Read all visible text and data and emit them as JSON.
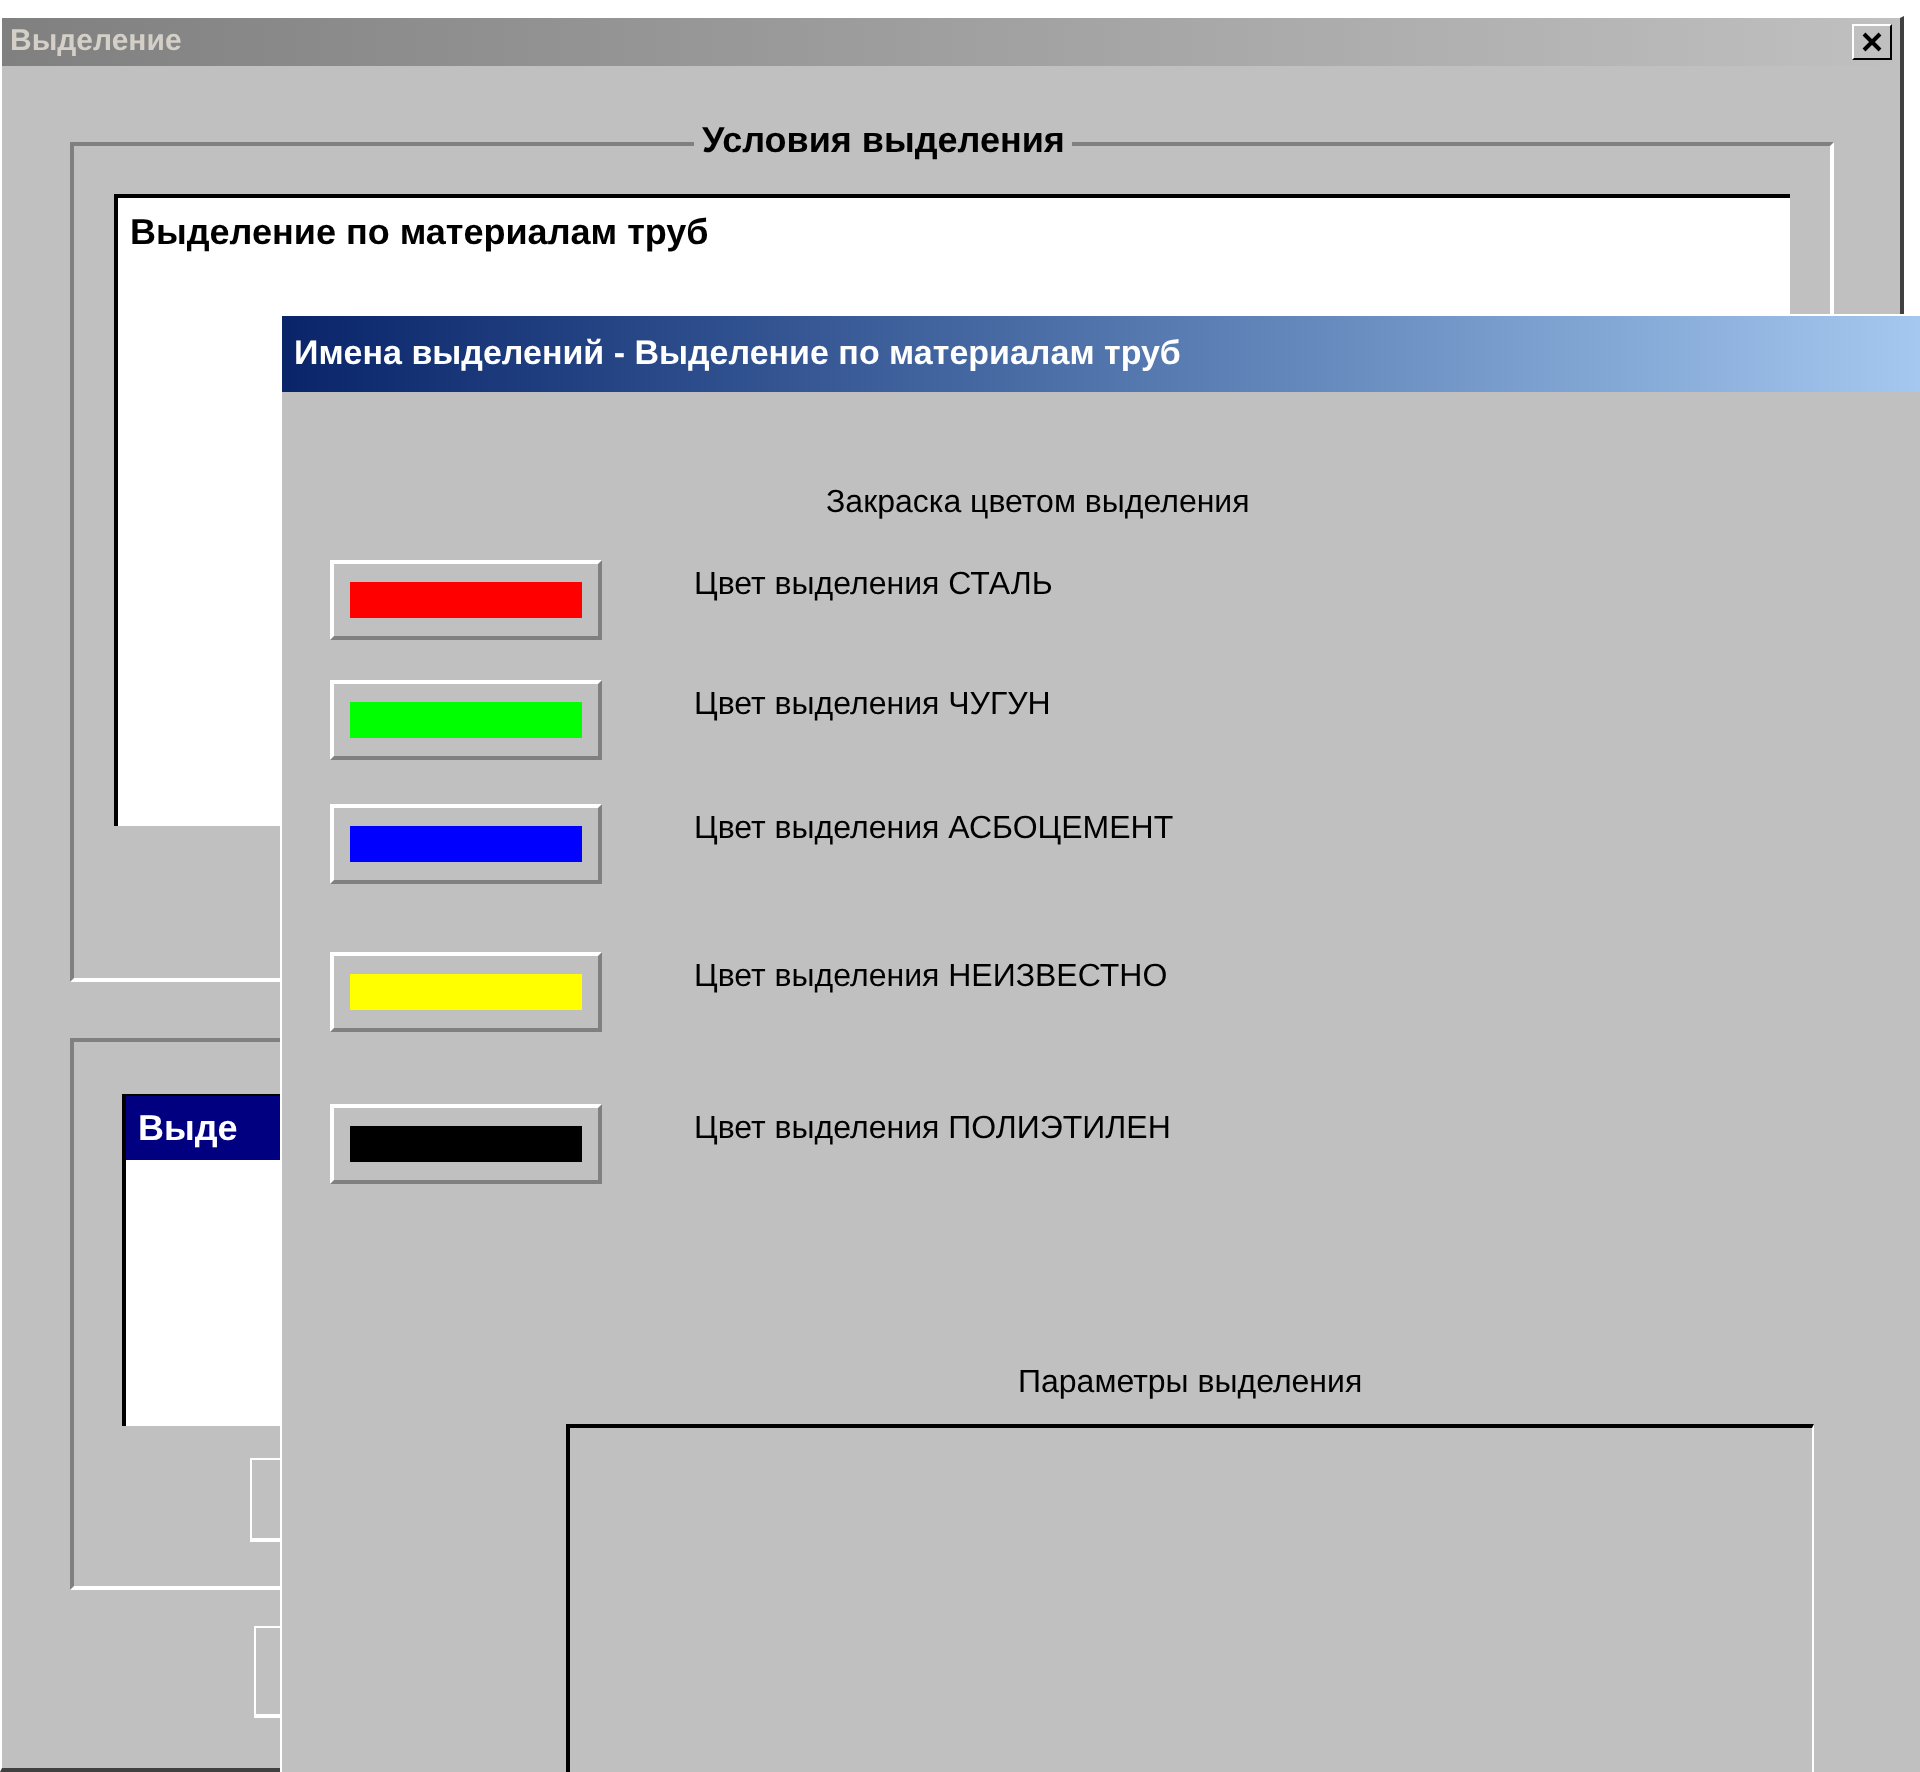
{
  "back_window": {
    "title": "Выделение",
    "conditions_group": {
      "title": "Условия выделения",
      "text": "Выделение по материалам труб"
    },
    "list": {
      "items": [
        {
          "label": "Выде",
          "selected": true
        }
      ]
    }
  },
  "front_window": {
    "title": "Имена выделений - Выделение по материалам труб",
    "heading": "Закраска цветом выделения",
    "colors": [
      {
        "label": "Цвет выделения СТАЛЬ",
        "color": "#ff0000"
      },
      {
        "label": "Цвет выделения ЧУГУН",
        "color": "#00ff00"
      },
      {
        "label": "Цвет выделения АСБОЦЕМЕНТ",
        "color": "#0000ff"
      },
      {
        "label": "Цвет выделения НЕИЗВЕСТНО",
        "color": "#ffff00"
      },
      {
        "label": "Цвет выделения ПОЛИЭТИЛЕН",
        "color": "#000000"
      }
    ],
    "params_title": "Параметры выделения"
  }
}
